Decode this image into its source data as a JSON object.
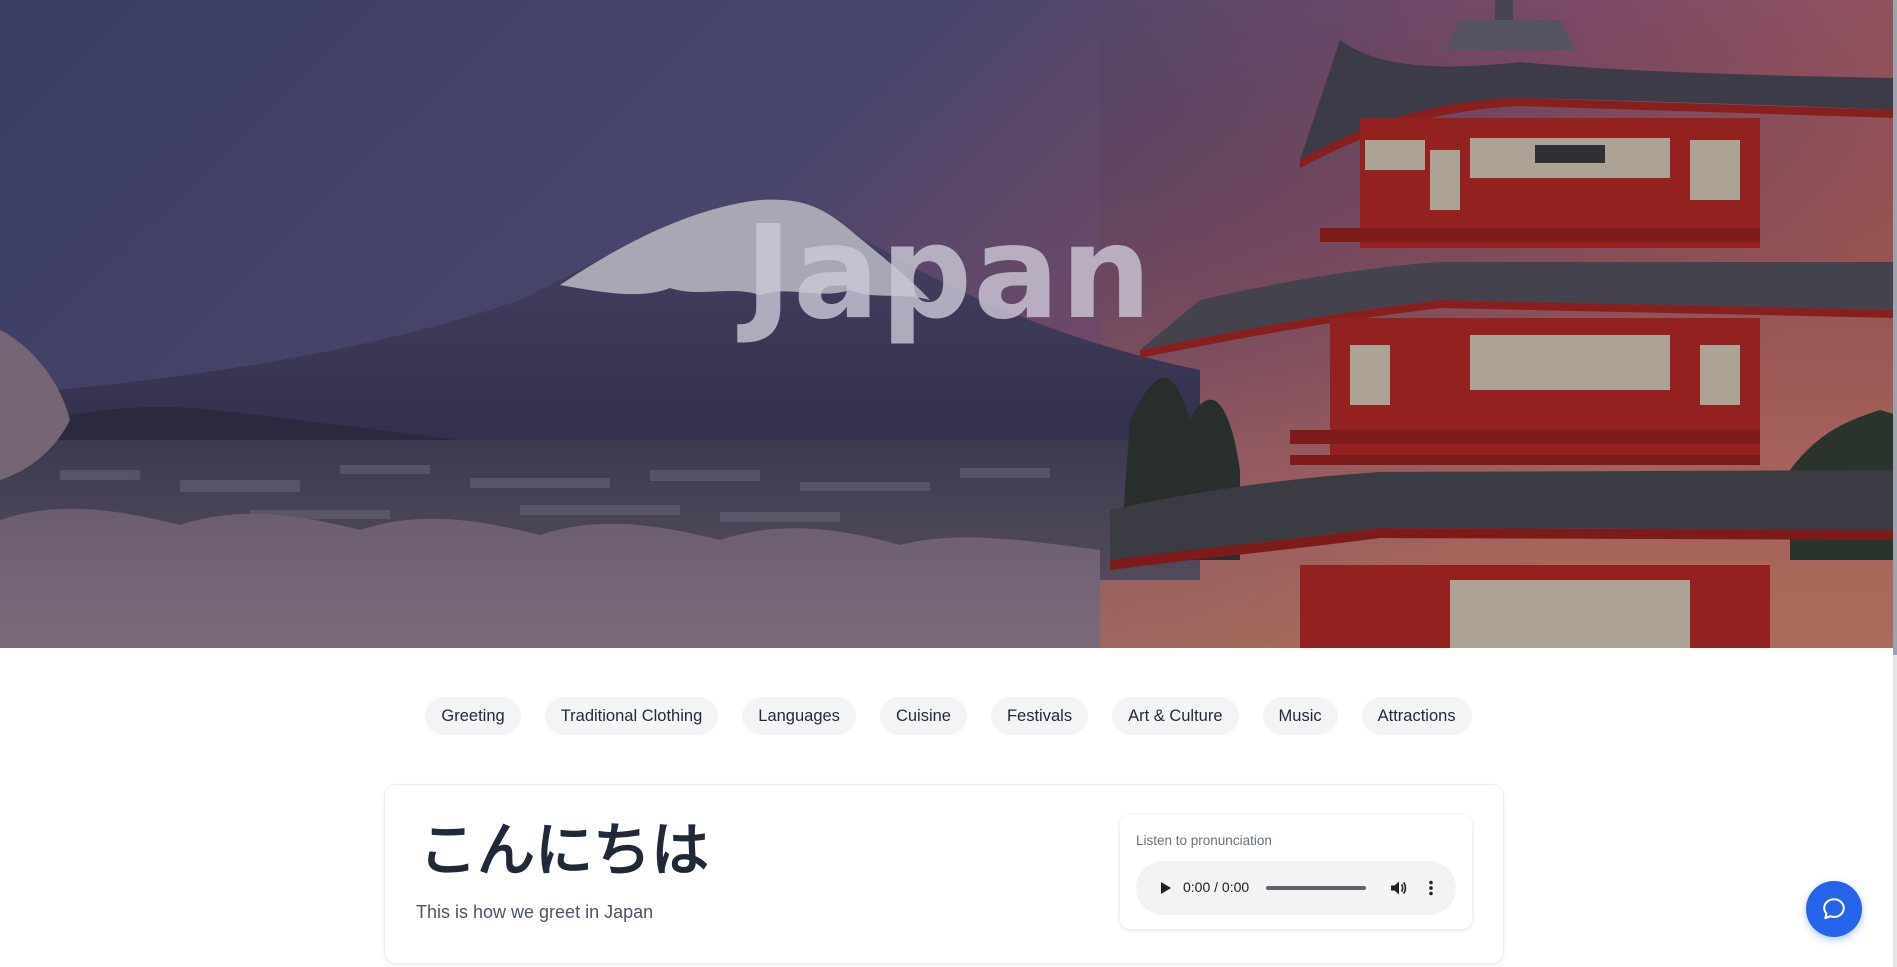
{
  "hero": {
    "title": "Japan",
    "image": "mount-fuji-chureito-pagoda-cherry-blossoms"
  },
  "tabs": [
    {
      "label": "Greeting"
    },
    {
      "label": "Traditional Clothing"
    },
    {
      "label": "Languages"
    },
    {
      "label": "Cuisine"
    },
    {
      "label": "Festivals"
    },
    {
      "label": "Art & Culture"
    },
    {
      "label": "Music"
    },
    {
      "label": "Attractions"
    }
  ],
  "greeting": {
    "word": "こんにちは",
    "caption": "This is how we greet in Japan"
  },
  "audio": {
    "label": "Listen to pronunciation",
    "time": "0:00 / 0:00",
    "icons": [
      "play-icon",
      "volume-icon",
      "more-vertical-icon"
    ]
  },
  "chat": {
    "icon": "chat-bubble-icon"
  },
  "colors": {
    "accent": "#2563eb",
    "tab_background": "#f3f4f6",
    "text_primary": "#1f2937",
    "text_secondary": "#4b5563",
    "pagoda_red": "#b3241c"
  }
}
